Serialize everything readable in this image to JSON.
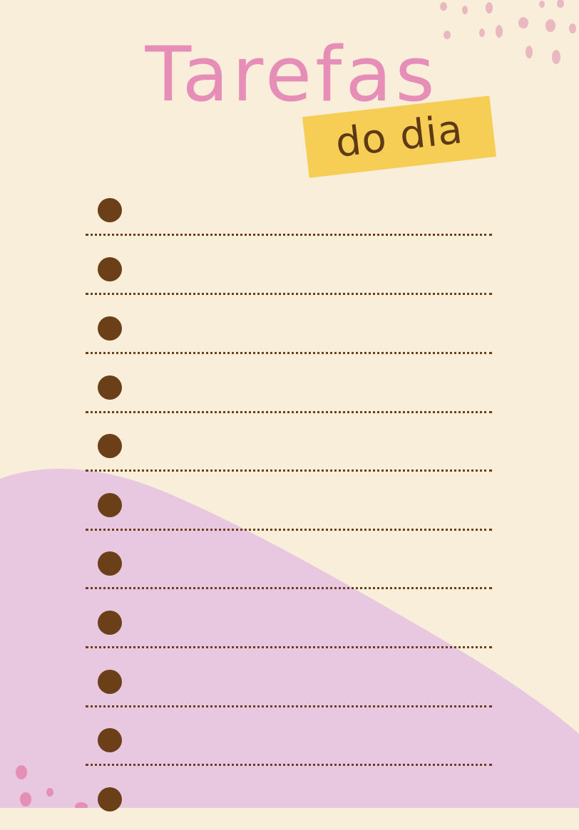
{
  "title": "Tarefas",
  "subtitle": "do dia",
  "colors": {
    "background": "#f8eed9",
    "title": "#e68db8",
    "subtitle_band": "#f6cd55",
    "subtitle_text": "#5e3a14",
    "bullet": "#6b3f17",
    "dotted_line": "#6b3f17",
    "lavender_blob": "#e8c8e0",
    "speckles": "#e9b8c0",
    "pink_dots": "#e58fb6"
  },
  "task_list": {
    "bullet_icon": "filled-circle",
    "items": [
      "",
      "",
      "",
      "",
      "",
      "",
      "",
      "",
      "",
      "",
      ""
    ]
  }
}
